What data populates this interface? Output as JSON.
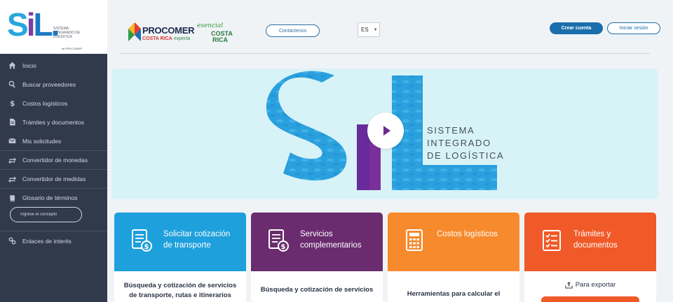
{
  "logo": {
    "letters": [
      "S",
      "i",
      "L."
    ],
    "subtitle": "SISTEMA INTEGRADO DE LOGÍSTICA",
    "tiny": "de PROCOMER"
  },
  "sidebar": {
    "items": [
      {
        "label": "Inicio",
        "icon": "home-icon"
      },
      {
        "label": "Buscar proveedores",
        "icon": "search-icon"
      },
      {
        "label": "Costos logísticos",
        "icon": "dollar-icon"
      },
      {
        "label": "Trámites y documentos",
        "icon": "document-icon"
      },
      {
        "label": "Mis solicitudes",
        "icon": "envelope-icon"
      },
      {
        "label": "Convertidor de monedas",
        "icon": "exchange-icon"
      },
      {
        "label": "Convertidor de medidas",
        "icon": "exchange-icon"
      },
      {
        "label": "Glosario de términos",
        "icon": "book-icon"
      }
    ],
    "glossary_placeholder": "Ingrese el concepto",
    "links_label": "Enlaces de interés"
  },
  "header": {
    "procomer_name": "PROCOMER",
    "procomer_sub_a": "COSTA RICA",
    "procomer_sub_b": "experta",
    "esencial_script": "esencial",
    "esencial_cr": "COSTA RICA",
    "contact": "Contáctenos",
    "language": "ES",
    "create_account": "Crear cuenta",
    "login": "Iniciar sesión"
  },
  "hero": {
    "line1": "SISTEMA",
    "line2": "INTEGRADO",
    "line3": "DE LOGÍSTICA"
  },
  "cards": [
    {
      "title_1": "Solicitar cotización",
      "title_2": "de transporte",
      "color": "#1ea0dc",
      "desc": "Búsqueda y cotización de servicios de transporte, rutas e itinerarios",
      "icon": "invoice-dollar-icon"
    },
    {
      "title_1": "Servicios",
      "title_2": "complementarios",
      "color": "#6a2c6e",
      "desc": "Búsqueda y cotización de servicios",
      "icon": "invoice-dollar-icon"
    },
    {
      "title_1": "Costos logísticos",
      "title_2": "",
      "color": "#f78a2d",
      "desc": "Herramientas para calcular el",
      "icon": "calculator-icon"
    },
    {
      "title_1": "Trámites y",
      "title_2": "documentos",
      "color": "#f05a28",
      "export": "Para exportar",
      "icon": "checklist-icon"
    }
  ]
}
